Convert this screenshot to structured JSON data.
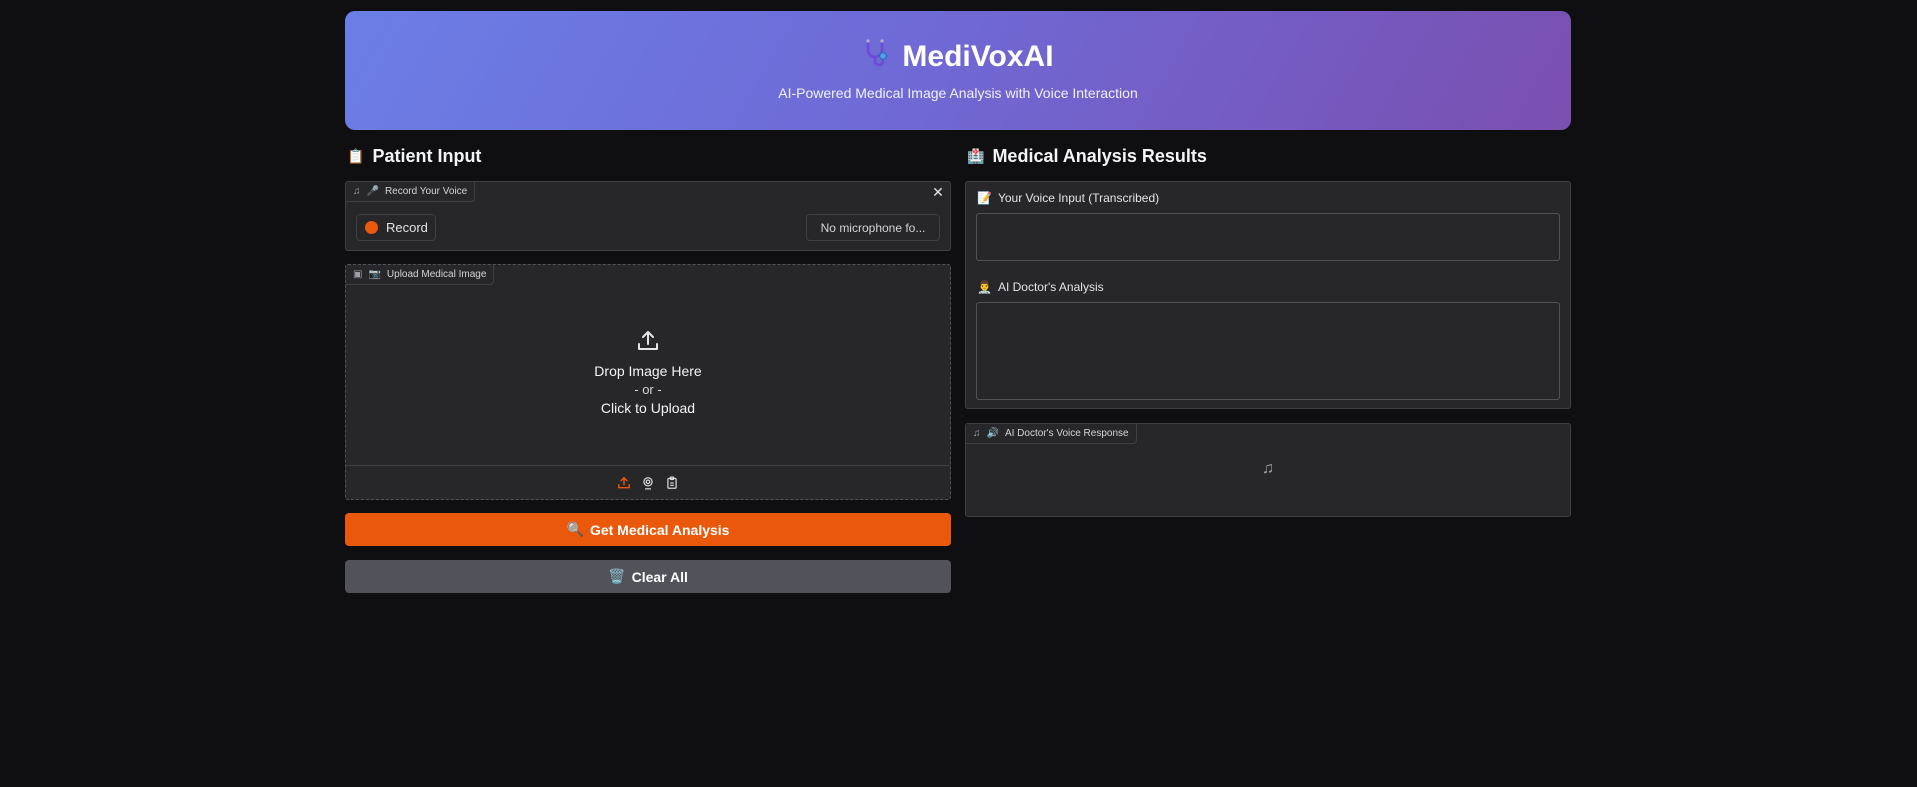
{
  "header": {
    "icon": "stethoscope-icon",
    "title": "MediVoxAI",
    "subtitle": "AI-Powered Medical Image Analysis with Voice Interaction",
    "gradient_start": "#6b7fe6",
    "gradient_end": "#7a4fb0"
  },
  "patient_input": {
    "section_icon": "📋",
    "section_title": "Patient Input",
    "voice": {
      "tag_icon": "🎤",
      "tag_label": "Record Your Voice",
      "record_label": "Record",
      "mic_label": "No microphone fo..."
    },
    "image_upload": {
      "tag_icon": "📷",
      "tag_label": "Upload Medical Image",
      "drop_text": "Drop Image Here",
      "or_text": "- or -",
      "click_text": "Click to Upload"
    },
    "analyze_button": {
      "icon": "🔍",
      "label": "Get Medical Analysis"
    },
    "clear_button": {
      "icon": "🗑️",
      "label": "Clear All"
    }
  },
  "results": {
    "section_icon": "🏥",
    "section_title": "Medical Analysis Results",
    "transcription_icon": "📝",
    "transcription_label": "Your Voice Input (Transcribed)",
    "transcription_value": "",
    "analysis_icon": "👨‍⚕️",
    "analysis_label": "AI Doctor's Analysis",
    "analysis_value": "",
    "voice_response": {
      "tag_icon": "🔊",
      "tag_label": "AI Doctor's Voice Response"
    }
  },
  "colors": {
    "accent": "#ea580c",
    "secondary": "#52525b",
    "background": "#0f0f11",
    "panel": "#27272a"
  }
}
